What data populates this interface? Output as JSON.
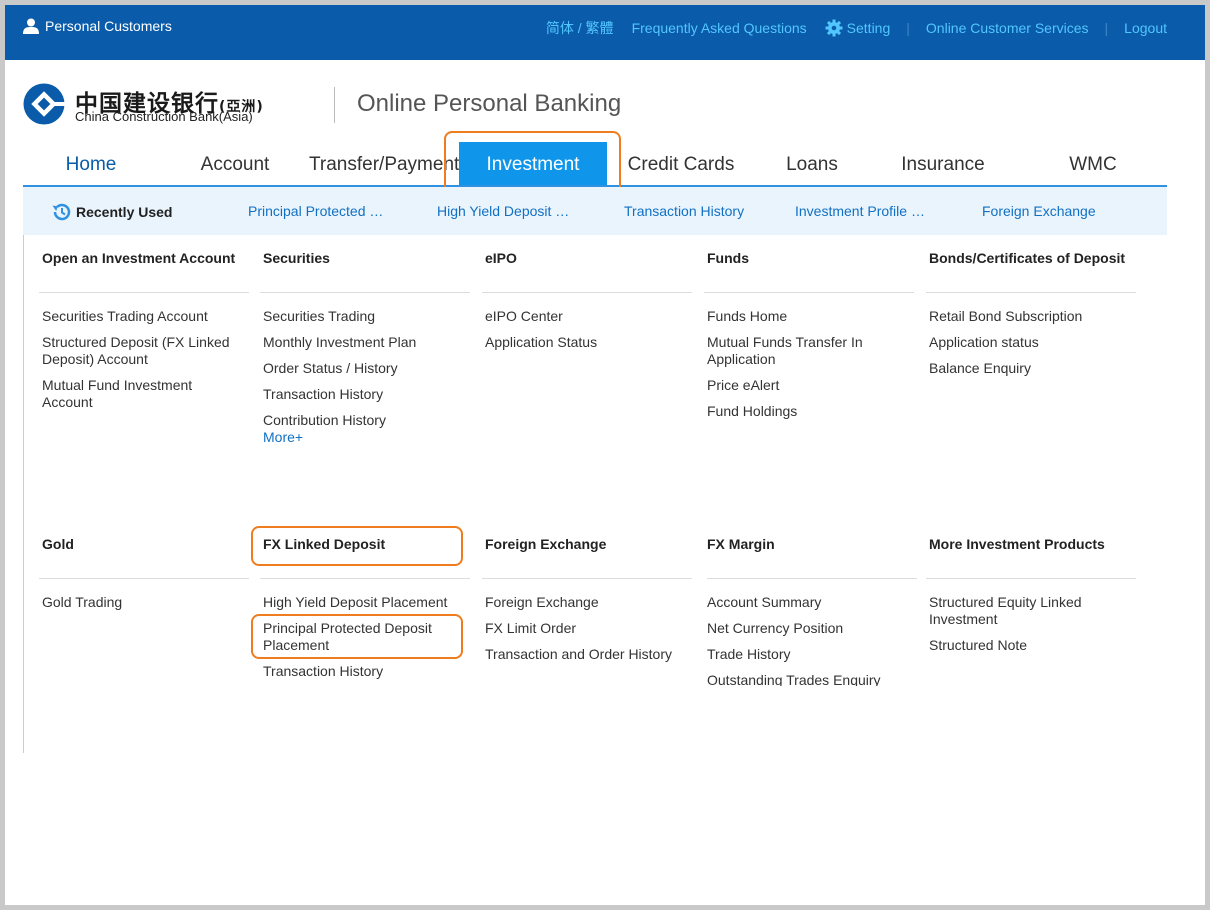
{
  "topbar": {
    "personal_customers": "Personal Customers",
    "lang": "简体 / 繁體",
    "faq": "Frequently Asked Questions",
    "setting": "Setting",
    "online_cs": "Online Customer Services",
    "logout": "Logout",
    "separator": "|"
  },
  "header": {
    "bank_cn": "中国建设银行",
    "bank_cn_suffix": "(亞洲)",
    "bank_en": "China Construction Bank(Asia)",
    "title": "Online Personal Banking"
  },
  "nav": {
    "tabs": [
      {
        "label": "Home"
      },
      {
        "label": "Account"
      },
      {
        "label": "Transfer/Payment"
      },
      {
        "label": "Investment"
      },
      {
        "label": "Credit Cards"
      },
      {
        "label": "Loans"
      },
      {
        "label": "Insurance"
      },
      {
        "label": "WMC"
      }
    ]
  },
  "recent": {
    "label": "Recently Used",
    "links": [
      "Principal Protected …",
      "High Yield Deposit …",
      "Transaction History",
      "Investment Profile …",
      "Foreign Exchange"
    ]
  },
  "menu": {
    "row1": [
      {
        "head": "Open an Investment Account",
        "items": [
          "Securities Trading Account",
          "Structured Deposit (FX Linked Deposit) Account",
          "Mutual Fund Investment Account"
        ]
      },
      {
        "head": "Securities",
        "items": [
          "Securities Trading",
          "Monthly Investment Plan",
          "Order Status / History",
          "Transaction History",
          "Contribution History"
        ],
        "more": "More+"
      },
      {
        "head": "eIPO",
        "items": [
          "eIPO Center",
          "Application Status"
        ]
      },
      {
        "head": "Funds",
        "items": [
          "Funds Home",
          "Mutual Funds Transfer In Application",
          "Price eAlert",
          "Fund Holdings"
        ]
      },
      {
        "head": "Bonds/Certificates of Deposit",
        "items": [
          "Retail Bond Subscription",
          "Application status",
          "Balance Enquiry"
        ]
      }
    ],
    "row2": [
      {
        "head": "Gold",
        "items": [
          "Gold Trading"
        ]
      },
      {
        "head": "FX Linked Deposit",
        "items": [
          "High Yield Deposit Placement",
          "Principal Protected Deposit Placement",
          "Transaction History"
        ]
      },
      {
        "head": "Foreign Exchange",
        "items": [
          "Foreign Exchange",
          "FX Limit Order",
          "Transaction and Order History"
        ]
      },
      {
        "head": "FX Margin",
        "items": [
          "Account Summary",
          "Net Currency Position",
          "Trade History",
          "Outstanding Trades Enquiry"
        ]
      },
      {
        "head": "More Investment Products",
        "items": [
          "Structured Equity Linked Investment",
          "Structured Note"
        ]
      }
    ]
  },
  "colors": {
    "topbar": "#0a5ba9",
    "accent": "#0f96ea",
    "link": "#1170c3",
    "highlight": "#ef7d20"
  }
}
